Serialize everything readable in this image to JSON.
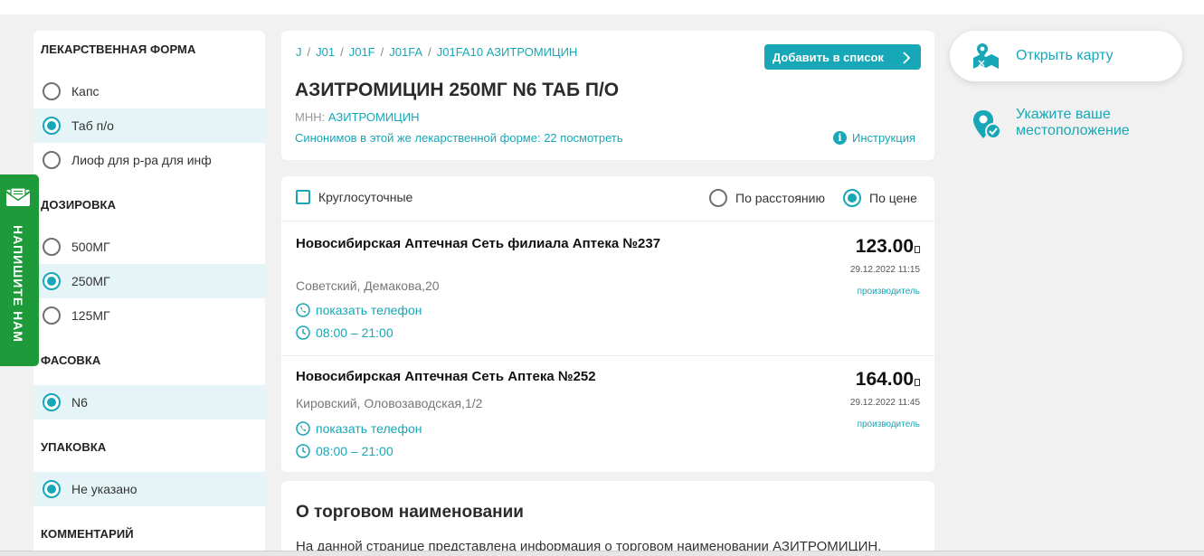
{
  "filters": {
    "form": {
      "title": "ЛЕКАРСТВЕННАЯ ФОРМА",
      "options": [
        {
          "label": "Капс",
          "selected": false
        },
        {
          "label": "Таб п/о",
          "selected": true
        },
        {
          "label": "Лиоф для р-ра для инф",
          "selected": false
        }
      ]
    },
    "dosage": {
      "title": "ДОЗИРОВКА",
      "options": [
        {
          "label": "500МГ",
          "selected": false
        },
        {
          "label": "250МГ",
          "selected": true
        },
        {
          "label": "125МГ",
          "selected": false
        }
      ]
    },
    "pack": {
      "title": "ФАСОВКА",
      "options": [
        {
          "label": "N6",
          "selected": true
        }
      ]
    },
    "packaging": {
      "title": "УПАКОВКА",
      "options": [
        {
          "label": "Не указано",
          "selected": true
        }
      ]
    },
    "comment": {
      "title": "КОММЕНТАРИЙ"
    }
  },
  "feedback": {
    "label": "НАПИШИТЕ НАМ",
    "icon": "envelope-icon",
    "color": "#1f9a3b"
  },
  "product": {
    "breadcrumbs": [
      "J",
      "J01",
      "J01F",
      "J01FA",
      "J01FA10 АЗИТРОМИЦИН"
    ],
    "breadcrumb_sep": "/",
    "add_button": "Добавить в список",
    "title": "АЗИТРОМИЦИН 250МГ N6 ТАБ П/О",
    "mnn_label": "МНН:",
    "mnn_value": "АЗИТРОМИЦИН",
    "synonyms": "Синонимов в этой же лекарственной форме: 22 посмотреть",
    "instruction": "Инструкция"
  },
  "sort": {
    "checkbox_label": "Круглосуточные",
    "by_distance": "По расстоянию",
    "by_price": "По цене",
    "selected": "price"
  },
  "pharmacies": [
    {
      "name": "Новосибирская Аптечная Сеть филиала Аптека №237",
      "address": "Советский, Демакова,20",
      "phone_link": "показать телефон",
      "hours": "08:00 – 21:00",
      "price": "123.00",
      "date": "29.12.2022 11:15",
      "maker_link": "производитель"
    },
    {
      "name": "Новосибирская Аптечная Сеть Аптека №252",
      "address": "Кировский, Оловозаводская,1/2",
      "phone_link": "показать телефон",
      "hours": "08:00 – 21:00",
      "price": "164.00",
      "date": "29.12.2022 11:45",
      "maker_link": "производитель"
    }
  ],
  "about": {
    "title": "О торговом наименовании",
    "text": "На данной странице представлена информация о торговом наименовании АЗИТРОМИЦИН,"
  },
  "right": {
    "map_button": "Открыть карту",
    "location_button": "Укажите ваше местоположение"
  },
  "colors": {
    "accent": "#17a7b6",
    "selected_bg": "#e5f4f6",
    "page_bg": "#f1f1f1"
  }
}
